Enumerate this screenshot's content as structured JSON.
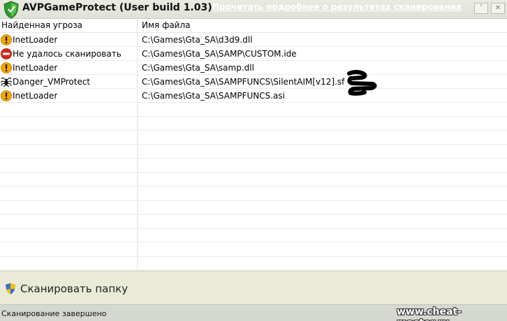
{
  "window": {
    "title": "AVPGameProtect (User build 1.03)",
    "details_link": "Прочитать подробнее о результатах сканирования",
    "minimize_glyph": "˅",
    "close_glyph": "✕"
  },
  "table": {
    "columns": [
      "Найденная угроза",
      "Имя файла"
    ],
    "rows": [
      {
        "icon": "warning-icon",
        "threat": "InetLoader",
        "path": "C:\\Games\\Gta_SA\\d3d9.dll"
      },
      {
        "icon": "no-entry-icon",
        "threat": "Не удалось сканировать",
        "path": "C:\\Games\\Gta_SA\\SAMP\\CUSTOM.ide"
      },
      {
        "icon": "warning-icon",
        "threat": "InetLoader",
        "path": "C:\\Games\\Gta_SA\\samp.dll"
      },
      {
        "icon": "spider-icon",
        "threat": "Danger_VMProtect",
        "path": "C:\\Games\\Gta_SA\\SAMPFUNCS\\SilentAIM[v12].sf"
      },
      {
        "icon": "warning-icon",
        "threat": "InetLoader",
        "path": "C:\\Games\\Gta_SA\\SAMPFUNCS.asi"
      }
    ],
    "empty_rows": 12
  },
  "scan": {
    "label": "Сканировать папку",
    "icon": "shield-icon"
  },
  "status": {
    "text": "Сканирование завершено"
  },
  "watermark": "www.cheat-master.ru",
  "colors": {
    "warning": "#f2a600",
    "error": "#d9261c",
    "panel": "#e9ebd7",
    "logo": "#2f9a2c"
  }
}
